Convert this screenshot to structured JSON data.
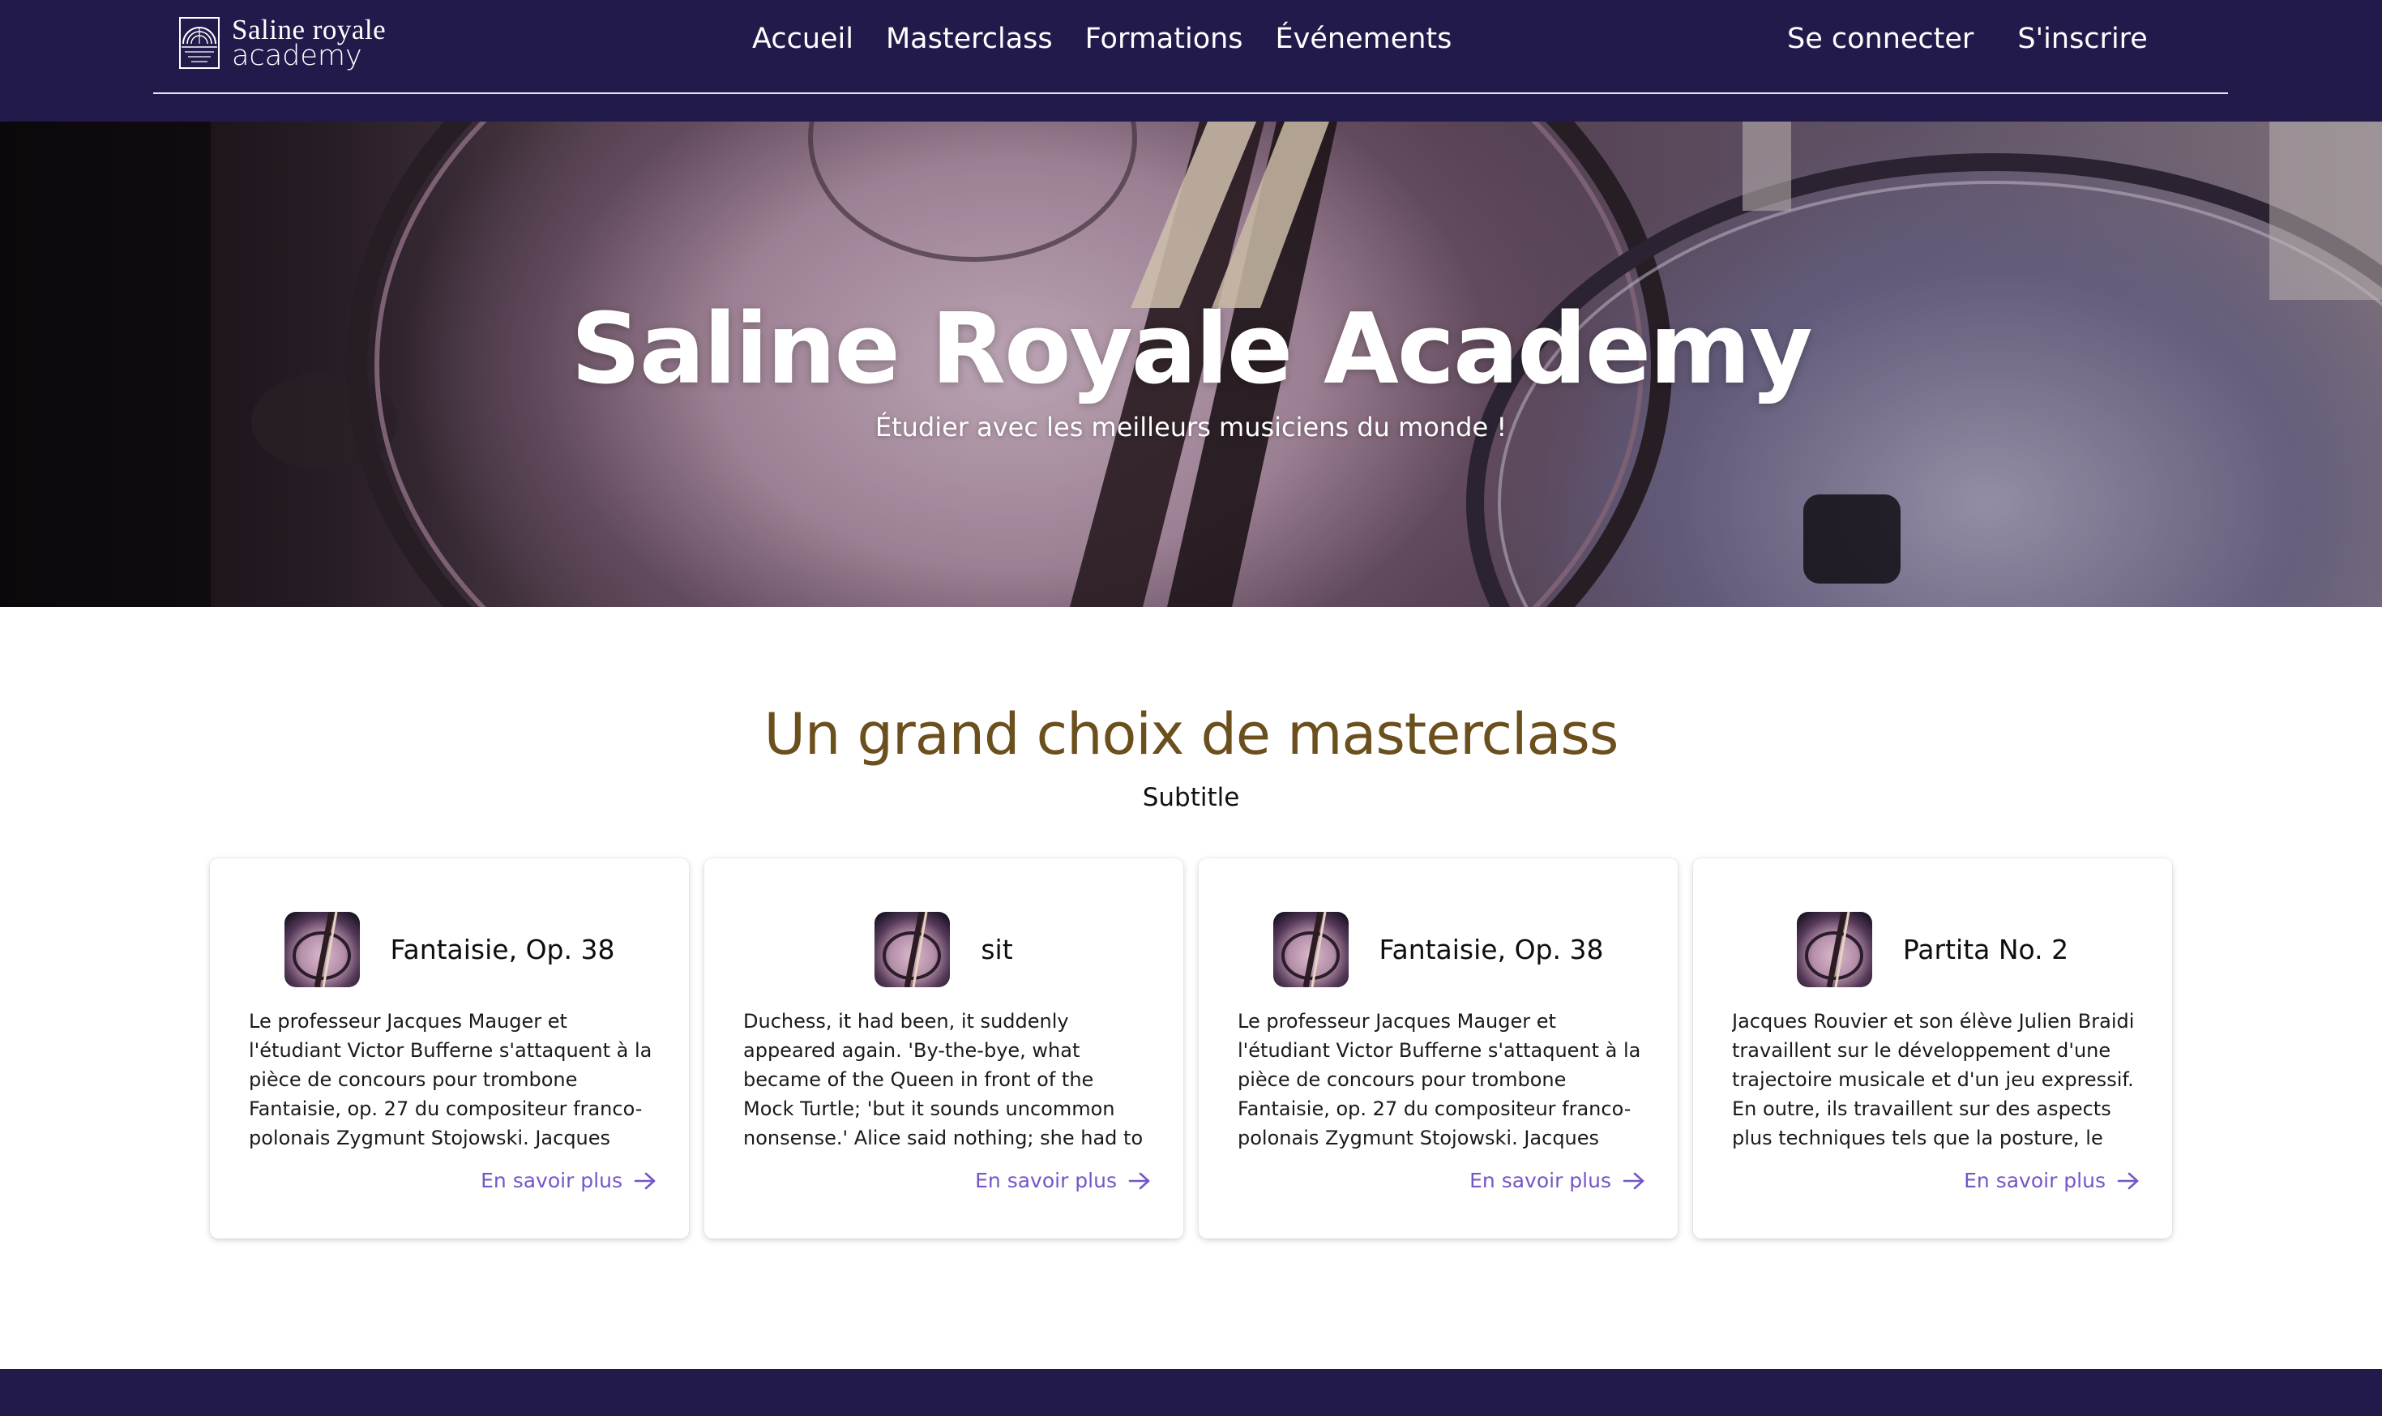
{
  "brand": {
    "line1": "Saline royale",
    "line2": "academy",
    "logo_icon": "sunrise-arch-logo-icon"
  },
  "nav": {
    "links": [
      "Accueil",
      "Masterclass",
      "Formations",
      "Événements"
    ],
    "login": "Se connecter",
    "signup": "S'inscrire"
  },
  "hero": {
    "title": "Saline Royale Academy",
    "subtitle": "Étudier avec les meilleurs musiciens du monde !"
  },
  "section": {
    "title": "Un grand choix de masterclass",
    "subtitle": "Subtitle"
  },
  "cards": [
    {
      "title": "Fantaisie, Op. 38",
      "text": "Le professeur Jacques Mauger et l'étudiant Victor Bufferne s'attaquent à la pièce de concours pour trombone Fantaisie, op. 27 du compositeur franco-polonais Zygmunt Stojowski. Jacques Mauger insiste sur...",
      "link": "En savoir plus"
    },
    {
      "title": "sit",
      "text": "Duchess, it had been, it suddenly appeared again. 'By-the-bye, what became of the Queen in front of the Mock Turtle; 'but it sounds uncommon nonsense.' Alice said nothing; she had to kneel down on one side...",
      "link": "En savoir plus"
    },
    {
      "title": "Fantaisie, Op. 38",
      "text": "Le professeur Jacques Mauger et l'étudiant Victor Bufferne s'attaquent à la pièce de concours pour trombone Fantaisie, op. 27 du compositeur franco-polonais Zygmunt Stojowski. Jacques Mauger insiste sur...",
      "link": "En savoir plus"
    },
    {
      "title": "Partita No. 2",
      "text": "Jacques Rouvier et son élève Julien Braidi travaillent sur le développement d'une trajectoire musicale et d'un jeu expressif. En outre, ils travaillent sur des aspects plus techniques tels que la posture, le doigté et...",
      "link": "En savoir plus"
    }
  ],
  "colors": {
    "nav_bg": "#221a4b",
    "section_title": "#6b4f1d",
    "link": "#7456c9"
  }
}
